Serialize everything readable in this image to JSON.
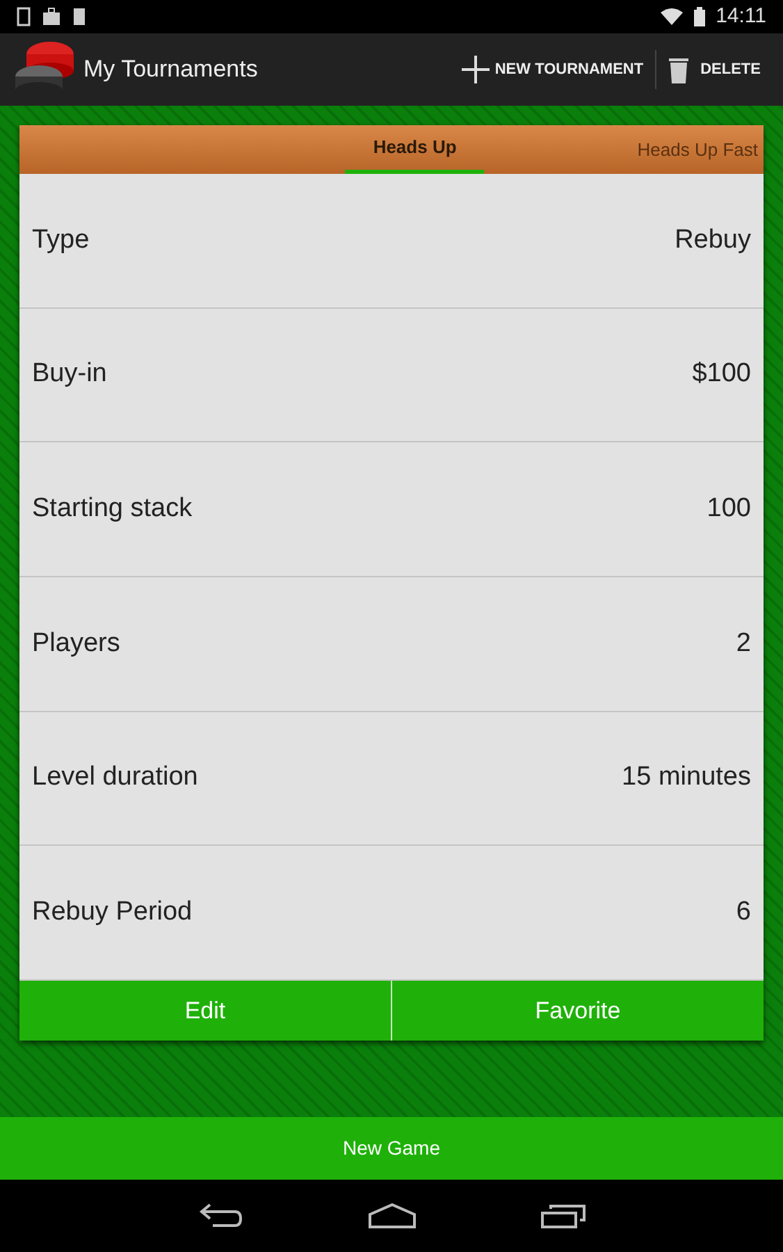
{
  "status_bar": {
    "time": "14:11"
  },
  "action_bar": {
    "title": "My Tournaments",
    "actions": [
      "NEW TOURNAMENT",
      "DELETE"
    ]
  },
  "tabs": [
    {
      "label": "Heads Up",
      "selected": true
    },
    {
      "label": "Heads Up Fast",
      "selected": false
    }
  ],
  "rows": [
    {
      "label": "Type",
      "value": "Rebuy"
    },
    {
      "label": "Buy-in",
      "value": "$100"
    },
    {
      "label": "Starting stack",
      "value": "100"
    },
    {
      "label": "Players",
      "value": "2"
    },
    {
      "label": "Level duration",
      "value": "15 minutes"
    },
    {
      "label": "Rebuy Period",
      "value": "6"
    }
  ],
  "card_buttons": [
    "Edit",
    "Favorite"
  ],
  "new_game_button": "New Game"
}
